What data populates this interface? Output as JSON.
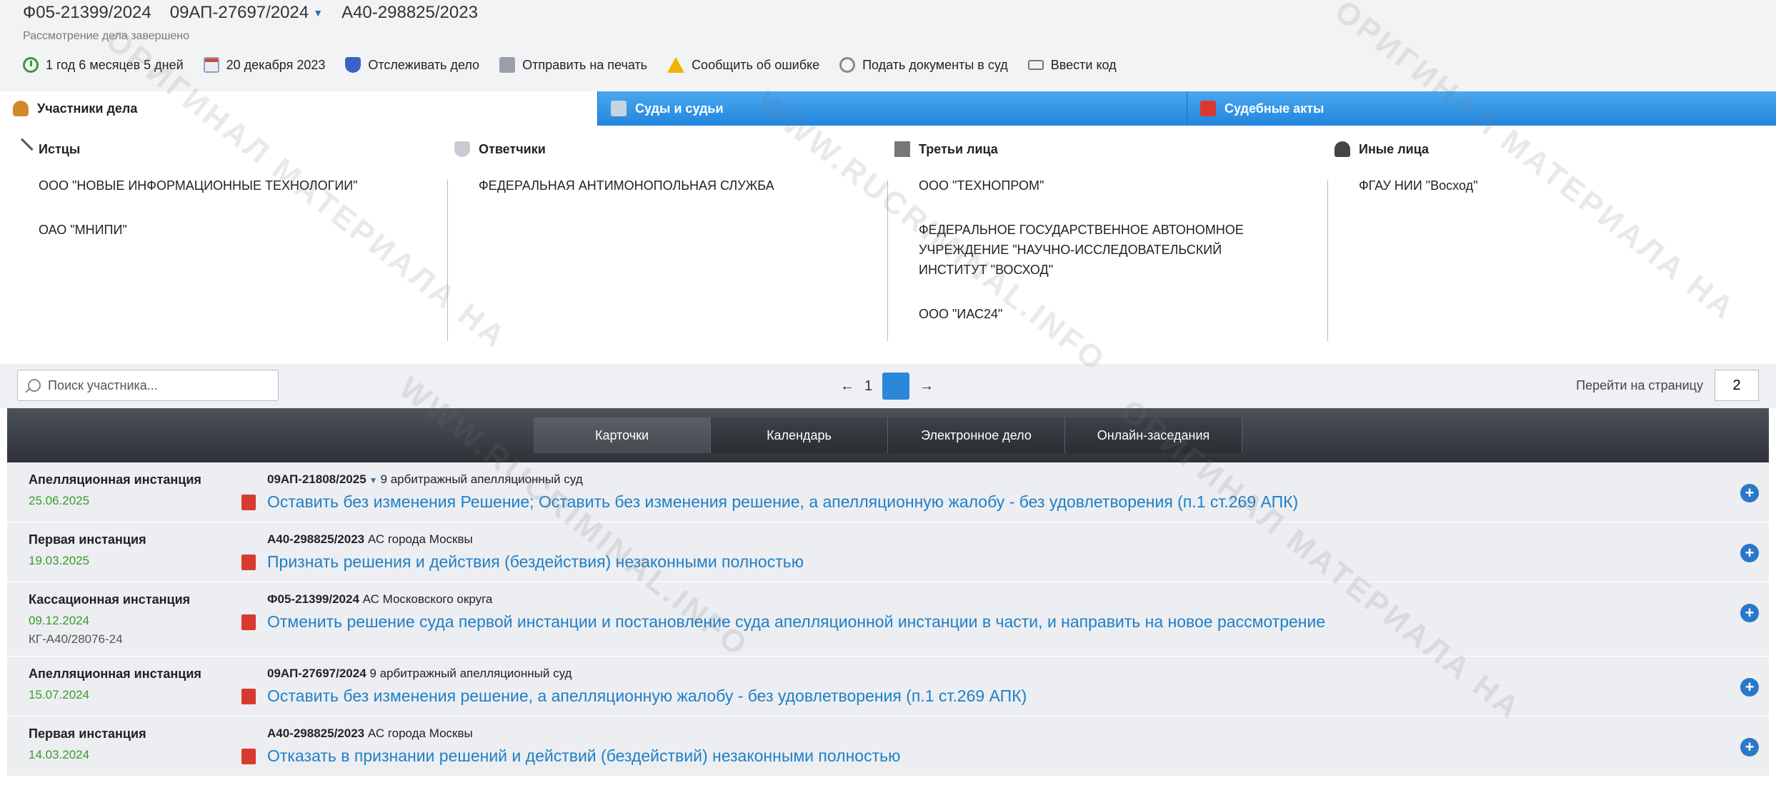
{
  "header": {
    "case_numbers": [
      "Ф05-21399/2024",
      "09АП-27697/2024",
      "А40-298825/2023"
    ],
    "status": "Рассмотрение дела завершено",
    "toolbar": [
      {
        "label": "1 год 6 месяцев 5 дней",
        "icon": "clock-icon"
      },
      {
        "label": "20 декабря 2023",
        "icon": "calendar-icon"
      },
      {
        "label": "Отслеживать дело",
        "icon": "shield-icon"
      },
      {
        "label": "Отправить на печать",
        "icon": "printer-icon"
      },
      {
        "label": "Сообщить об ошибке",
        "icon": "warning-icon"
      },
      {
        "label": "Подать документы в суд",
        "icon": "court-icon"
      },
      {
        "label": "Ввести код",
        "icon": "code-icon"
      }
    ]
  },
  "tabs": [
    {
      "label": "Участники дела",
      "icon": "users-icon"
    },
    {
      "label": "Суды и судьи",
      "icon": "bank-icon"
    },
    {
      "label": "Судебные акты",
      "icon": "pdf-icon"
    }
  ],
  "participants": {
    "plaintiffs": {
      "title": "Истцы",
      "items": [
        "ООО \"НОВЫЕ ИНФОРМАЦИОННЫЕ ТЕХНОЛОГИИ\"",
        "ОАО \"МНИПИ\""
      ]
    },
    "defendants": {
      "title": "Ответчики",
      "items": [
        "ФЕДЕРАЛЬНАЯ АНТИМОНОПОЛЬНАЯ СЛУЖБА"
      ]
    },
    "third_parties": {
      "title": "Третьи лица",
      "items": [
        "ООО \"ТЕХНОПРОМ\"",
        "ФЕДЕРАЛЬНОЕ ГОСУДАРСТВЕННОЕ АВТОНОМНОЕ УЧРЕЖДЕНИЕ \"НАУЧНО-ИССЛЕДОВАТЕЛЬСКИЙ ИНСТИТУТ \"ВОСХОД\"",
        "ООО \"ИАС24\""
      ]
    },
    "others": {
      "title": "Иные лица",
      "items": [
        "ФГАУ НИИ \"Восход\""
      ]
    }
  },
  "search": {
    "placeholder": "Поиск участника..."
  },
  "pager": {
    "prev": "←",
    "current": "1",
    "next": "→",
    "goto_label": "Перейти на страницу",
    "goto_value": "2"
  },
  "nav": [
    "Карточки",
    "Календарь",
    "Электронное дело",
    "Онлайн-заседания"
  ],
  "cases": [
    {
      "instance": "Апелляционная инстанция",
      "date": "25.06.2025",
      "extra": "",
      "number": "09АП-21808/2025",
      "dropdown": true,
      "court": "9 арбитражный апелляционный суд",
      "decision": "Оставить без изменения Решение; Оставить без изменения решение, а апелляционную жалобу - без удовлетворения (п.1 ст.269 АПК)"
    },
    {
      "instance": "Первая инстанция",
      "date": "19.03.2025",
      "extra": "",
      "number": "А40-298825/2023",
      "dropdown": false,
      "court": "АС города Москвы",
      "decision": "Признать решения и действия (бездействия) незаконными полностью"
    },
    {
      "instance": "Кассационная инстанция",
      "date": "09.12.2024",
      "extra": "КГ-А40/28076-24",
      "number": "Ф05-21399/2024",
      "dropdown": false,
      "court": "АС Московского округа",
      "decision": "Отменить решение суда первой инстанции и постановление суда апелляционной инстанции в части, и направить на новое рассмотрение"
    },
    {
      "instance": "Апелляционная инстанция",
      "date": "15.07.2024",
      "extra": "",
      "number": "09АП-27697/2024",
      "dropdown": false,
      "court": "9 арбитражный апелляционный суд",
      "decision": "Оставить без изменения решение, а апелляционную жалобу - без удовлетворения (п.1 ст.269 АПК)"
    },
    {
      "instance": "Первая инстанция",
      "date": "14.03.2024",
      "extra": "",
      "number": "А40-298825/2023",
      "dropdown": false,
      "court": "АС города Москвы",
      "decision": "Отказать в признании решений и действий (бездействий) незаконными полностью"
    }
  ],
  "watermark": [
    "ОРИГИНАЛ МАТЕРИАЛА НА",
    "WWW.RUCRIMINAL.INFO"
  ]
}
